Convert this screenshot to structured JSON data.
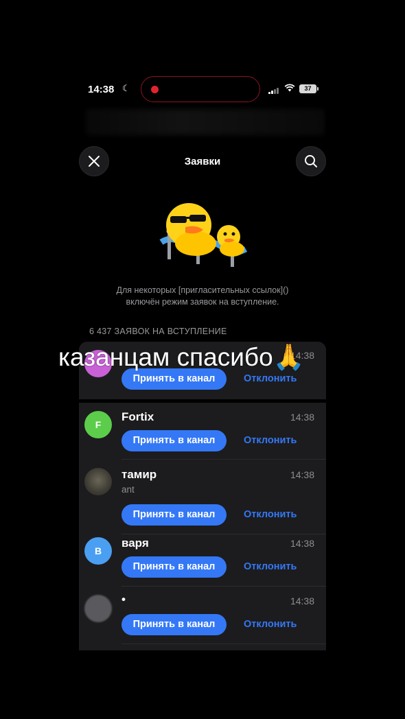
{
  "status_bar": {
    "time": "14:38",
    "battery": "37"
  },
  "header": {
    "title": "Заявки"
  },
  "info": {
    "line1": "Для некоторых [пригласительных ссылок]()",
    "line2": "включён режим заявок на вступление."
  },
  "section_title": "6 437 ЗАЯВОК НА ВСТУПЛЕНИЕ",
  "overlay_caption": "казанцам спасибо🙏",
  "requests": [
    {
      "name": "",
      "sub": "",
      "time": "14:38",
      "accept": "Принять в канал",
      "decline": "Отклонить",
      "avatar_color": "#c861d6",
      "initial": ""
    },
    {
      "name": "Fortix",
      "sub": "",
      "time": "14:38",
      "accept": "Принять в канал",
      "decline": "Отклонить",
      "avatar_color": "#5ccd4b",
      "initial": "F"
    },
    {
      "name": "тамир",
      "sub": "ant",
      "time": "14:38",
      "accept": "Принять в канал",
      "decline": "Отклонить",
      "avatar_color": "#3a3a34",
      "initial": ""
    },
    {
      "name": "варя",
      "sub": "",
      "time": "14:38",
      "accept": "Принять в канал",
      "decline": "Отклонить",
      "avatar_color": "#4a9ff2",
      "initial": "В"
    },
    {
      "name": "•",
      "sub": "",
      "time": "14:38",
      "accept": "Принять в канал",
      "decline": "Отклонить",
      "avatar_color": "#5a5a5e",
      "initial": ""
    }
  ],
  "colors": {
    "accent": "#3478f6",
    "card": "#1c1c1e",
    "background": "#000000",
    "record": "#e0242f"
  }
}
